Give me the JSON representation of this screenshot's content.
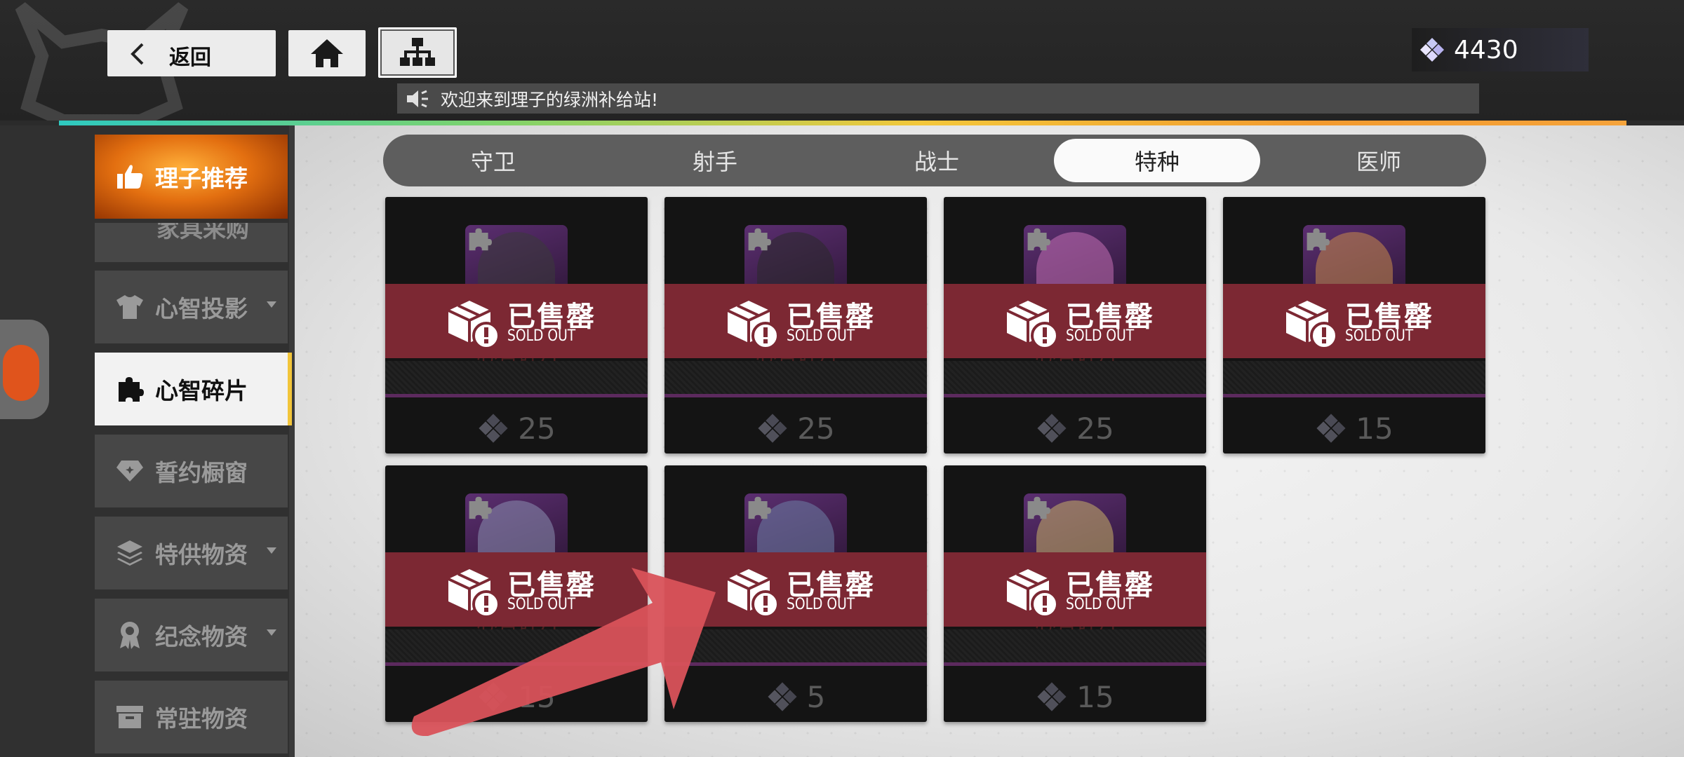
{
  "header": {
    "back_label": "返回",
    "notice_text": "欢迎来到理子的绿洲补给站!",
    "currency_amount": "4430"
  },
  "sidebar": {
    "items": [
      {
        "label": "理子推荐",
        "icon": "thumbs-up-icon",
        "state": "featured"
      },
      {
        "label": "家具采购",
        "icon": "furniture-icon",
        "state": "partial"
      },
      {
        "label": "心智投影",
        "icon": "tshirt-icon",
        "state": "normal",
        "has_dropdown": true
      },
      {
        "label": "心智碎片",
        "icon": "puzzle-icon",
        "state": "active"
      },
      {
        "label": "誓约橱窗",
        "icon": "diamond-icon",
        "state": "normal"
      },
      {
        "label": "特供物资",
        "icon": "layers-icon",
        "state": "normal",
        "has_dropdown": true
      },
      {
        "label": "纪念物资",
        "icon": "medal-icon",
        "state": "normal",
        "has_dropdown": true
      },
      {
        "label": "常驻物资",
        "icon": "box-icon",
        "state": "normal"
      }
    ]
  },
  "tabs": [
    {
      "label": "守卫"
    },
    {
      "label": "射手"
    },
    {
      "label": "战士"
    },
    {
      "label": "特种",
      "active": true
    },
    {
      "label": "医师"
    }
  ],
  "cards": [
    {
      "price": "25",
      "sold_label": "已售罄",
      "sold_sub": "SOLD OUT",
      "item_name": "心智碎片",
      "accent": "#3a3a3a"
    },
    {
      "price": "25",
      "sold_label": "已售罄",
      "sold_sub": "SOLD OUT",
      "item_name": "心智碎片",
      "accent": "#2a2a2a"
    },
    {
      "price": "25",
      "sold_label": "已售罄",
      "sold_sub": "SOLD OUT",
      "item_name": "心智碎片",
      "accent": "#c46fb5"
    },
    {
      "price": "15",
      "sold_label": "已售罄",
      "sold_sub": "SOLD OUT",
      "item_name": "",
      "accent": "#c98a4a"
    },
    {
      "price": "15",
      "sold_label": "已售罄",
      "sold_sub": "SOLD OUT",
      "item_name": "心智碎片",
      "accent": "#8a8fb0"
    },
    {
      "price": "5",
      "sold_label": "已售罄",
      "sold_sub": "SOLD OUT",
      "item_name": "",
      "accent": "#6e7fa6"
    },
    {
      "price": "15",
      "sold_label": "已售罄",
      "sold_sub": "SOLD OUT",
      "item_name": "心智碎片",
      "accent": "#c9b068"
    }
  ],
  "colors": {
    "sold_banner": "#7c2833",
    "active_accent": "#f2c53a",
    "annotation_arrow": "#d9525a"
  }
}
